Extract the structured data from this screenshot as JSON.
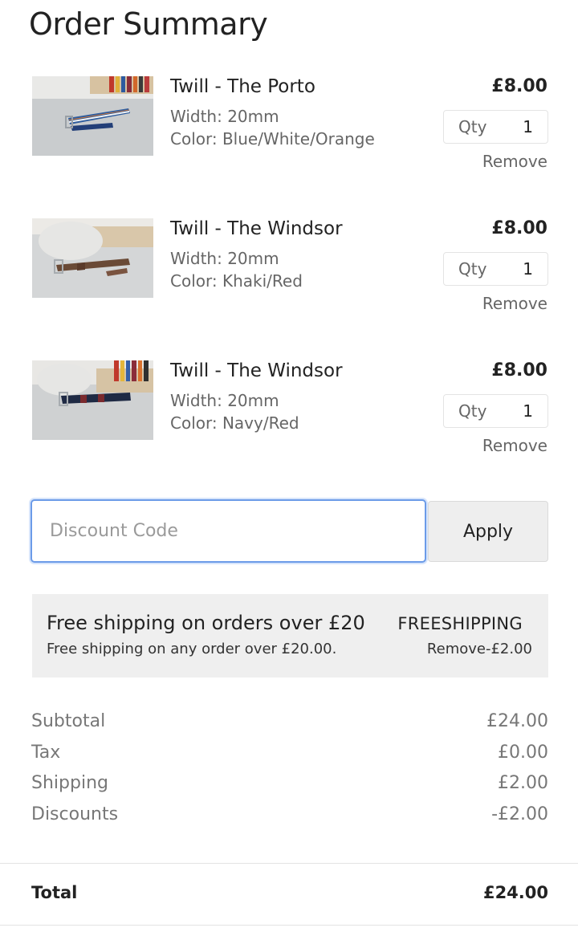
{
  "page": {
    "title": "Order Summary"
  },
  "items": [
    {
      "name": "Twill - The Porto",
      "width": "Width: 20mm",
      "color": "Color: Blue/White/Orange",
      "price": "£8.00",
      "qty_label": "Qty",
      "qty": "1",
      "remove_label": "Remove"
    },
    {
      "name": "Twill - The Windsor",
      "width": "Width: 20mm",
      "color": "Color: Khaki/Red",
      "price": "£8.00",
      "qty_label": "Qty",
      "qty": "1",
      "remove_label": "Remove"
    },
    {
      "name": "Twill - The Windsor",
      "width": "Width: 20mm",
      "color": "Color: Navy/Red",
      "price": "£8.00",
      "qty_label": "Qty",
      "qty": "1",
      "remove_label": "Remove"
    }
  ],
  "discount": {
    "placeholder": "Discount Code",
    "value": "",
    "apply_label": "Apply"
  },
  "promo": {
    "title": "Free shipping on orders over £20",
    "code": "FREESHIPPING",
    "description": "Free shipping on any order over £20.00.",
    "remove_label": "Remove",
    "amount": "-£2.00"
  },
  "summary": {
    "subtotal_label": "Subtotal",
    "subtotal": "£24.00",
    "tax_label": "Tax",
    "tax": "£0.00",
    "shipping_label": "Shipping",
    "shipping": "£2.00",
    "discounts_label": "Discounts",
    "discounts": "-£2.00",
    "total_label": "Total",
    "total": "£24.00"
  },
  "colors": {
    "focus_ring": "#6b9be8",
    "promo_bg": "#efefef",
    "button_bg": "#eeeeee"
  }
}
